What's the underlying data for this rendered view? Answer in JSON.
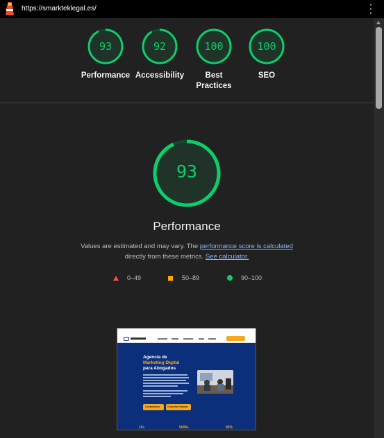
{
  "browser": {
    "url": "https://smarkteklegal.es/",
    "menu_icon": "kebab-menu-icon"
  },
  "summary": [
    {
      "score": "93",
      "label": "Performance",
      "status_color": "#0cce6b"
    },
    {
      "score": "92",
      "label": "Accessibility",
      "status_color": "#0cce6b"
    },
    {
      "score": "100",
      "label": "Best Practices",
      "status_color": "#0cce6b"
    },
    {
      "score": "100",
      "label": "SEO",
      "status_color": "#0cce6b"
    }
  ],
  "performance": {
    "score": "93",
    "score_fraction": 0.93,
    "title": "Performance",
    "desc_prefix": "Values are estimated and may vary. The ",
    "score_link": "performance score is calculated",
    "desc_mid": "directly from these metrics. ",
    "calc_link": "See calculator."
  },
  "legend": [
    {
      "range": "0–49",
      "shape": "triangle",
      "color": "#ff4e42"
    },
    {
      "range": "50–89",
      "shape": "square",
      "color": "#ffa400"
    },
    {
      "range": "90–100",
      "shape": "circle",
      "color": "#0cce6b"
    }
  ],
  "thumbnail": {
    "headline_1": "Agencia de",
    "headline_2": "Marketing Digital",
    "headline_3": "para Abogados",
    "button_1": "Contáctanos",
    "button_2": "Consulta Gratuita",
    "stat_1": "15+",
    "stat_2": "5000+",
    "stat_3": "95%",
    "accent_color": "#f7a823",
    "hero_color": "#0b2f7a"
  },
  "colors": {
    "background": "#212121",
    "pass": "#0cce6b",
    "link": "#8ab4f8"
  }
}
